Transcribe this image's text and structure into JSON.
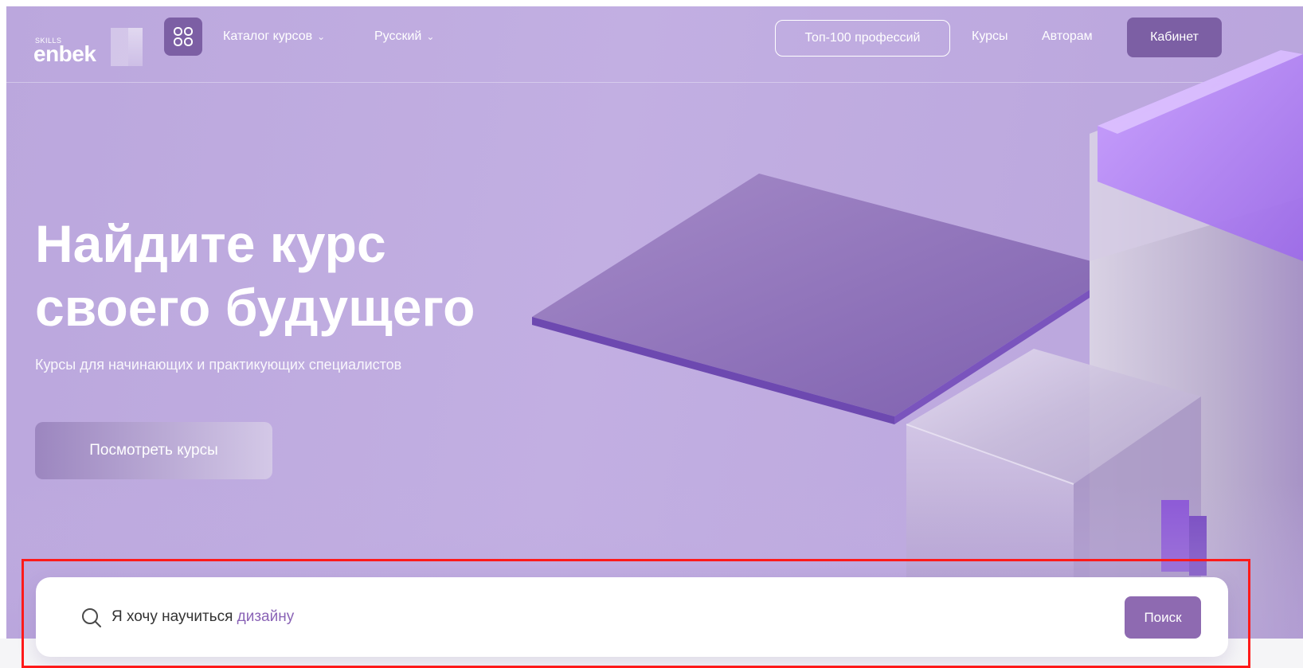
{
  "header": {
    "logo_small": "SKILLS",
    "logo_word": "enbek",
    "nav": [
      {
        "label": "Каталог курсов"
      },
      {
        "label": "Русский"
      }
    ],
    "top_professions_label": "Топ-100 профессий",
    "courses_label": "Курсы",
    "authors_label": "Авторам",
    "cabinet_label": "Кабинет"
  },
  "hero": {
    "title_line1": "Найдите курс",
    "title_line2": "своего будущего",
    "subtitle": "Курсы для начинающих и практикующих специалистов",
    "cta_label": "Посмотреть курсы"
  },
  "search": {
    "prefix": "Я хочу научиться",
    "highlight": "дизайну",
    "button_label": "Поиск"
  },
  "colors": {
    "hero_bg": "#c2afe2",
    "accent": "#7c5fa4",
    "search_button": "#8e6ab1",
    "highlight_border": "#ff1a1a"
  },
  "icons": [
    "grid-icon",
    "chevron-down-icon",
    "search-icon"
  ]
}
